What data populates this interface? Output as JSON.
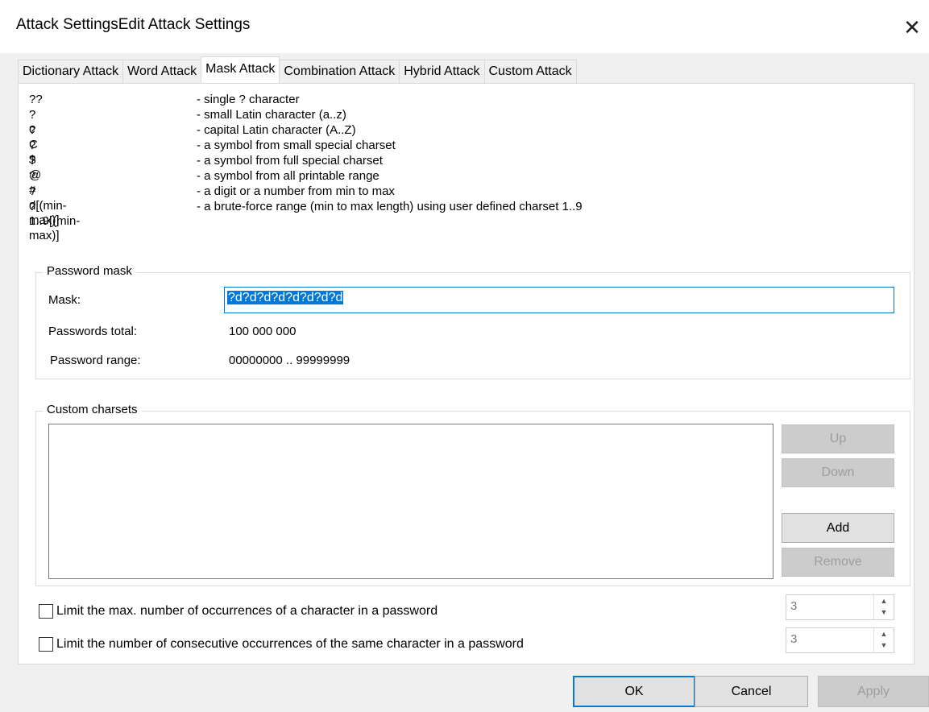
{
  "window": {
    "title": "Attack SettingsEdit Attack Settings",
    "close_glyph": "✕"
  },
  "tabs": [
    {
      "label": "Dictionary Attack",
      "active": false
    },
    {
      "label": "Word Attack",
      "active": false
    },
    {
      "label": "Mask Attack",
      "active": true
    },
    {
      "label": "Combination Attack",
      "active": false
    },
    {
      "label": "Hybrid Attack",
      "active": false
    },
    {
      "label": "Custom Attack",
      "active": false
    }
  ],
  "legend": [
    {
      "key": "??",
      "desc": "- single ? character"
    },
    {
      "key": "?c",
      "desc": "- small Latin character (a..z)"
    },
    {
      "key": "?C",
      "desc": "- capital Latin character (A..Z)"
    },
    {
      "key": "?$",
      "desc": "- a symbol from small special charset"
    },
    {
      "key": "?@",
      "desc": "- a symbol from full special charset"
    },
    {
      "key": "?#",
      "desc": "- a symbol from all printable range"
    },
    {
      "key": "?d[(min-max)]",
      "desc": "- a digit or a number from min to max"
    },
    {
      "key": "?1..9[(min-max)]",
      "desc": "- a brute-force range (min to max length) using user defined charset 1..9"
    }
  ],
  "password_mask": {
    "group_title": "Password mask",
    "mask_label": "Mask:",
    "mask_value": "?d?d?d?d?d?d?d?d",
    "total_label": "Passwords total:",
    "total_value": "100 000 000",
    "range_label": "Password range:",
    "range_value": "00000000 .. 99999999"
  },
  "custom_charsets": {
    "group_title": "Custom charsets",
    "up_label": "Up",
    "down_label": "Down",
    "add_label": "Add",
    "remove_label": "Remove"
  },
  "limits": {
    "max_occurrences_label": "Limit the max. number of occurrences of a character in a password",
    "max_occurrences_value": "3",
    "consecutive_label": "Limit the number of consecutive occurrences of the same character in a password",
    "consecutive_value": "3"
  },
  "footer": {
    "ok_label": "OK",
    "cancel_label": "Cancel",
    "apply_label": "Apply"
  },
  "icons": {
    "spin_up": "▲",
    "spin_down": "▼"
  }
}
